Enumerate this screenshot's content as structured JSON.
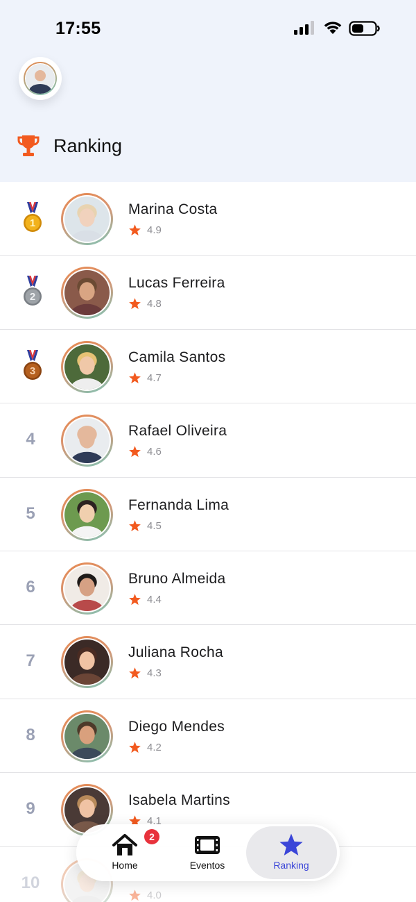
{
  "status_bar": {
    "time": "17:55"
  },
  "header": {
    "title": "Ranking"
  },
  "ranking": [
    {
      "rank": "1",
      "medal": "gold-medal",
      "name": "Marina Costa",
      "rating": "4.9",
      "skin": "#f1d2bd",
      "hair": "#e8d3b0",
      "bg": "#dde5ea",
      "shirt": "#d9dfe6"
    },
    {
      "rank": "2",
      "medal": "silver-medal",
      "name": "Lucas Ferreira",
      "rating": "4.8",
      "skin": "#d9a583",
      "hair": "#6b4a33",
      "bg": "#8a5a4a",
      "shirt": "#6b3b3b"
    },
    {
      "rank": "3",
      "medal": "bronze-medal",
      "name": "Camila Santos",
      "rating": "4.7",
      "skin": "#f0c8a8",
      "hair": "#e6c274",
      "bg": "#4d6a3a",
      "shirt": "#eeeeee"
    },
    {
      "rank": "4",
      "medal": null,
      "name": "Rafael Oliveira",
      "rating": "4.6",
      "skin": "#e4b89c",
      "hair": "#e4b89c",
      "bg": "#e9ecef",
      "shirt": "#2e3b57"
    },
    {
      "rank": "5",
      "medal": null,
      "name": "Fernanda Lima",
      "rating": "4.5",
      "skin": "#f0cfae",
      "hair": "#2b2220",
      "bg": "#6d9a4f",
      "shirt": "#f4f4f4"
    },
    {
      "rank": "6",
      "medal": null,
      "name": "Bruno Almeida",
      "rating": "4.4",
      "skin": "#d6a184",
      "hair": "#1e1a18",
      "bg": "#f0ebe6",
      "shirt": "#b84a4a"
    },
    {
      "rank": "7",
      "medal": null,
      "name": "Juliana Rocha",
      "rating": "4.3",
      "skin": "#f0c3a4",
      "hair": "#4a2b22",
      "bg": "#3b2a26",
      "shirt": "#6b4536"
    },
    {
      "rank": "8",
      "medal": null,
      "name": "Diego Mendes",
      "rating": "4.2",
      "skin": "#d9a07d",
      "hair": "#4d3a2a",
      "bg": "#6b8a6a",
      "shirt": "#3c4a5a"
    },
    {
      "rank": "9",
      "medal": null,
      "name": "Isabela Martins",
      "rating": "4.1",
      "skin": "#f0c3a4",
      "hair": "#b88a5a",
      "bg": "#4a3a36",
      "shirt": "#7a5a4a"
    },
    {
      "rank": "10",
      "medal": null,
      "name": "",
      "rating": "4.0",
      "skin": "#f0d2bd",
      "hair": "#e8d3b0",
      "bg": "#e6e6e6",
      "shirt": "#dddddd"
    }
  ],
  "tab_bar": {
    "tabs": [
      {
        "label": "Home",
        "icon": "home-icon",
        "badge": "2"
      },
      {
        "label": "Eventos",
        "icon": "film-icon"
      },
      {
        "label": "Ranking",
        "icon": "star-icon",
        "active": true
      }
    ]
  },
  "colors": {
    "accent": "#3a45d8",
    "star": "#f25a1f",
    "trophy": "#f25a1f",
    "badge": "#e8323c"
  }
}
